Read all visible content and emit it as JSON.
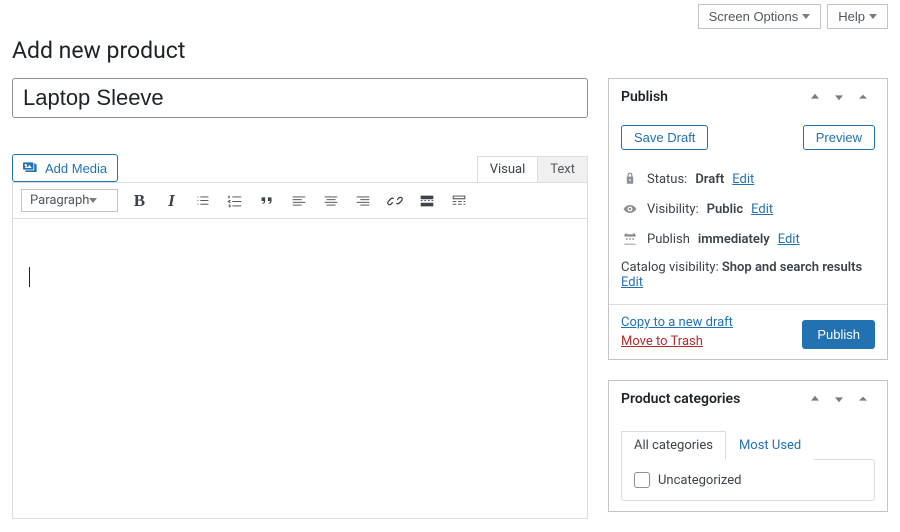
{
  "top": {
    "screen_options": "Screen Options",
    "help": "Help"
  },
  "page_title": "Add new product",
  "title_field": {
    "value": "Laptop Sleeve"
  },
  "editor": {
    "add_media": "Add Media",
    "tabs": {
      "visual": "Visual",
      "text": "Text"
    },
    "format_select": "Paragraph"
  },
  "publish": {
    "heading": "Publish",
    "save_draft": "Save Draft",
    "preview": "Preview",
    "status_label": "Status:",
    "status_value": "Draft",
    "visibility_label": "Visibility:",
    "visibility_value": "Public",
    "publish_label": "Publish",
    "publish_value": "immediately",
    "catalog_label": "Catalog visibility:",
    "catalog_value": "Shop and search results",
    "edit": "Edit",
    "copy_link": "Copy to a new draft",
    "trash_link": "Move to Trash",
    "publish_btn": "Publish"
  },
  "categories": {
    "heading": "Product categories",
    "tab_all": "All categories",
    "tab_used": "Most Used",
    "items": [
      {
        "label": "Uncategorized",
        "checked": false
      }
    ]
  }
}
